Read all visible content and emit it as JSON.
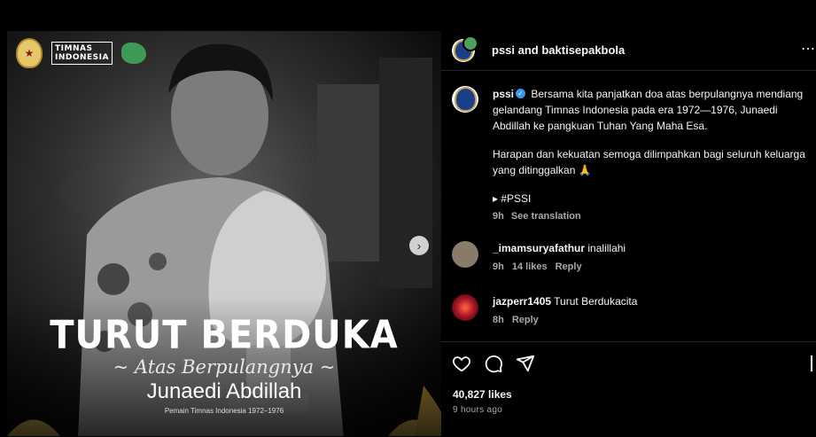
{
  "media": {
    "brand": {
      "timnas_line1": "TIMNAS",
      "timnas_line2": "INDONESIA"
    },
    "title": "TURUT BERDUKA",
    "subtitle": "~ Atas Berpulangnya ~",
    "name": "Junaedi Abdillah",
    "caption_small": "Pemain Timnas Indonesia 1972–1976",
    "next_glyph": "›"
  },
  "header": {
    "accounts": "pssi and baktisepakbola",
    "more": "⋯"
  },
  "caption": {
    "username": "pssi",
    "verified_glyph": "✓",
    "para1": "Bersama kita panjatkan doa atas berpulangnya mendiang gelandang Timnas Indonesia pada era 1972—1976, Junaedi Abdillah ke pangkuan Tuhan Yang Maha Esa.",
    "para2": "Harapan dan kekuatan semoga dilimpahkan bagi seluruh keluarga yang ditinggalkan 🙏",
    "hashtag": "▸ #PSSI",
    "time": "9h",
    "see_translation": "See translation"
  },
  "comments": [
    {
      "username": "_imamsuryafathur",
      "text": "inalillahi",
      "time": "9h",
      "likes": "14 likes",
      "reply": "Reply",
      "avatar_color": "#8a7a6a"
    },
    {
      "username": "jazperr1405",
      "text": "Turut Berdukacita",
      "time": "8h",
      "reply": "Reply",
      "avatar_color": "#c0392b"
    }
  ],
  "actions": {
    "icons": [
      "heart-icon",
      "comment-icon",
      "share-icon",
      "bookmark-icon"
    ],
    "likes": "40,827 likes",
    "ago": "9 hours ago"
  }
}
